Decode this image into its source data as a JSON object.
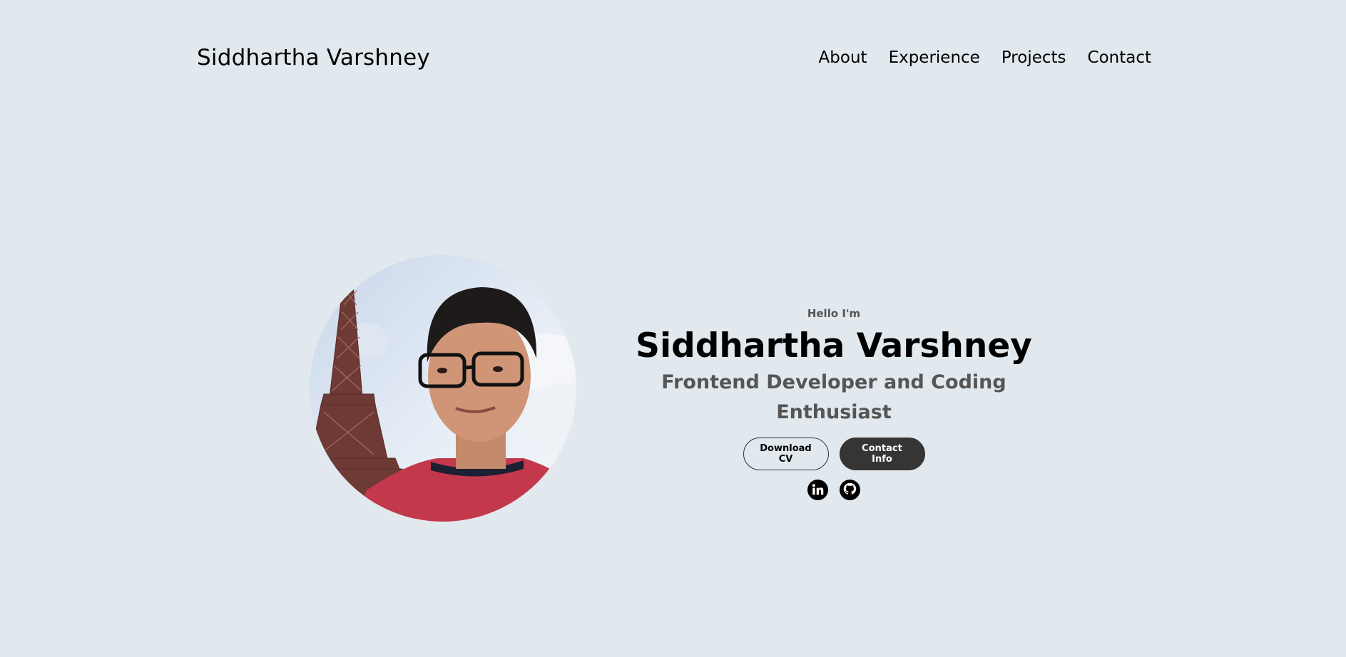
{
  "nav": {
    "logo": "Siddhartha Varshney",
    "links": [
      "About",
      "Experience",
      "Projects",
      "Contact"
    ]
  },
  "hero": {
    "greeting": "Hello I'm",
    "name": "Siddhartha Varshney",
    "role": "Frontend Developer and Coding Enthusiast",
    "buttons": {
      "download_cv": "Download CV",
      "contact_info": "Contact Info"
    },
    "socials": [
      {
        "icon": "linkedin-icon"
      },
      {
        "icon": "github-icon"
      }
    ]
  },
  "colors": {
    "background": "#e1e9ee",
    "button_dark": "#353535",
    "subtext": "#555555"
  }
}
